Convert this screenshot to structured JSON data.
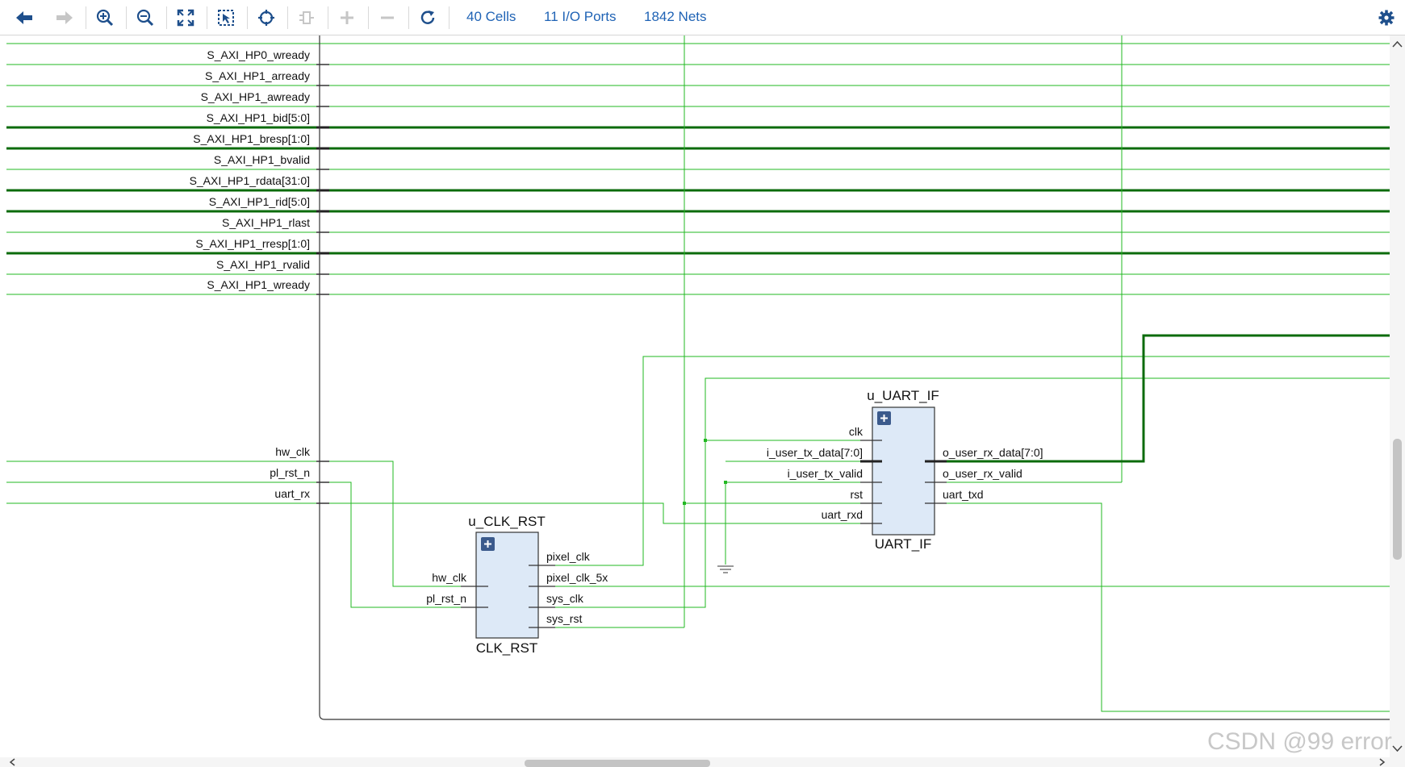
{
  "toolbar": {
    "stats": {
      "cells": "40 Cells",
      "io_ports": "11 I/O Ports",
      "nets": "1842 Nets"
    },
    "icons": [
      "back-arrow-icon",
      "forward-arrow-icon",
      "zoom-in-icon",
      "zoom-out-icon",
      "fit-view-icon",
      "select-area-icon",
      "locate-icon",
      "add-cell-icon",
      "plus-icon",
      "minus-icon",
      "refresh-icon",
      "settings-icon"
    ],
    "colors": {
      "stat_link": "#1f63b5",
      "icon": "#1e4f8c",
      "icon_disabled": "#c6c6c6"
    }
  },
  "schematic": {
    "port_labels": [
      "S_AXI_HP0_wready",
      "S_AXI_HP1_arready",
      "S_AXI_HP1_awready",
      "S_AXI_HP1_bid[5:0]",
      "S_AXI_HP1_bresp[1:0]",
      "S_AXI_HP1_bvalid",
      "S_AXI_HP1_rdata[31:0]",
      "S_AXI_HP1_rid[5:0]",
      "S_AXI_HP1_rlast",
      "S_AXI_HP1_rresp[1:0]",
      "S_AXI_HP1_rvalid",
      "S_AXI_HP1_wready"
    ],
    "top_inputs": [
      "hw_clk",
      "pl_rst_n",
      "uart_rx"
    ],
    "clk_rst": {
      "instance": "u_CLK_RST",
      "type": "CLK_RST",
      "inputs": [
        "hw_clk",
        "pl_rst_n"
      ],
      "outputs": [
        "pixel_clk",
        "pixel_clk_5x",
        "sys_clk",
        "sys_rst"
      ]
    },
    "uart_if": {
      "instance": "u_UART_IF",
      "type": "UART_IF",
      "inputs": [
        "clk",
        "i_user_tx_data[7:0]",
        "i_user_tx_valid",
        "rst",
        "uart_rxd"
      ],
      "outputs": [
        "o_user_rx_data[7:0]",
        "o_user_rx_valid",
        "uart_txd"
      ]
    },
    "colors": {
      "net": "#22b822",
      "bus": "#0b6b0b",
      "cell_fill": "#dde9f7",
      "cell_border": "#333333",
      "expand": "#3b5a8c"
    }
  },
  "watermark": "CSDN @99 error"
}
